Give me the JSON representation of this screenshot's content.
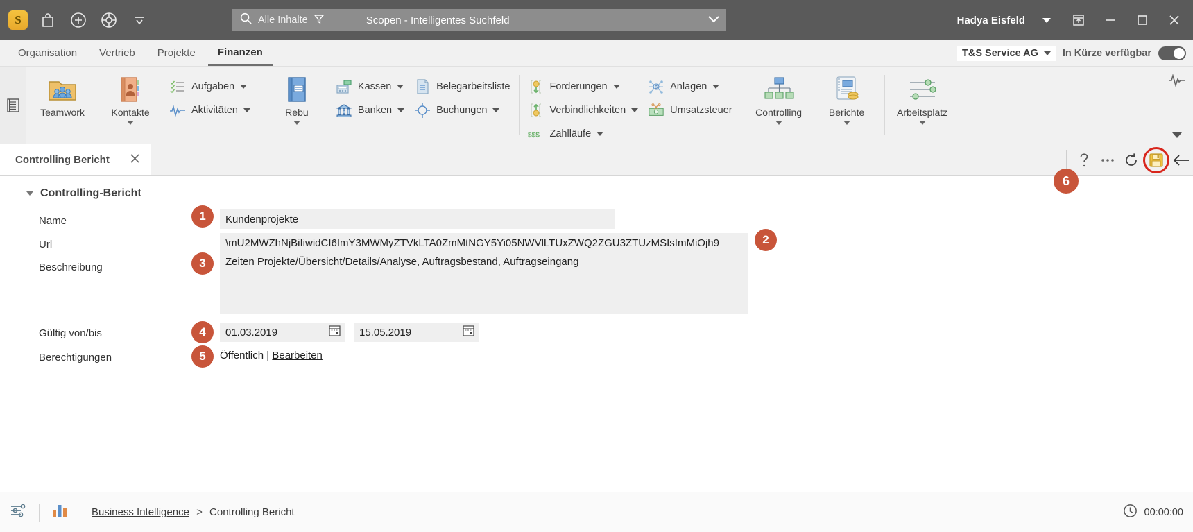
{
  "titlebar": {
    "logo_text": "S",
    "icons": [
      "bag-icon",
      "plus-circle-icon",
      "compass-icon",
      "chevron-down-icon"
    ],
    "search": {
      "scope_label": "Alle Inhalte",
      "filter_icon": "funnel-icon",
      "search_icon": "search-icon",
      "title": "Scopen - Intelligentes Suchfeld",
      "caret_icon": "chevron-down-icon"
    },
    "user": "Hadya Eisfeld",
    "user_caret_icon": "chevron-down-icon",
    "window_icons": [
      "restore-panel-icon",
      "minimize-icon",
      "maximize-icon",
      "close-icon"
    ]
  },
  "menubar": {
    "items": [
      {
        "label": "Organisation",
        "active": false
      },
      {
        "label": "Vertrieb",
        "active": false
      },
      {
        "label": "Projekte",
        "active": false
      },
      {
        "label": "Finanzen",
        "active": true
      }
    ],
    "company": "T&S Service AG",
    "availability_label": "In Kürze verfügbar",
    "toggle_on": true
  },
  "ribbon": {
    "rail_icon": "panel-list-icon",
    "groups": [
      {
        "big": [
          {
            "label": "Teamwork",
            "icon": "team-folder-icon",
            "caret": false
          },
          {
            "label": "Kontakte",
            "icon": "address-book-icon",
            "caret": true
          }
        ],
        "small": [
          {
            "label": "Aufgaben",
            "icon": "tasks-icon",
            "caret": true
          },
          {
            "label": "Aktivitäten",
            "icon": "activity-pulse-icon",
            "caret": true
          }
        ]
      },
      {
        "big": [
          {
            "label": "Rebu",
            "icon": "blue-book-icon",
            "caret": true
          }
        ],
        "small": [
          {
            "label": "Kassen",
            "icon": "cash-register-icon",
            "caret": true
          },
          {
            "label": "Banken",
            "icon": "bank-icon",
            "caret": true
          }
        ]
      },
      {
        "big": [],
        "small": [
          {
            "label": "Belegarbeitsliste",
            "icon": "document-list-icon",
            "caret": false
          },
          {
            "label": "Buchungen",
            "icon": "target-icon",
            "caret": true
          }
        ]
      },
      {
        "big": [],
        "small": [
          {
            "label": "Forderungen",
            "icon": "coin-in-icon",
            "caret": true
          },
          {
            "label": "Verbindlichkeiten",
            "icon": "coin-out-icon",
            "caret": true
          },
          {
            "label": "Zahlläufe",
            "icon": "money-flow-icon",
            "caret": true
          }
        ]
      },
      {
        "big": [],
        "small": [
          {
            "label": "Anlagen",
            "icon": "assets-network-icon",
            "caret": true
          },
          {
            "label": "Umsatzsteuer",
            "icon": "banknote-scissors-icon",
            "caret": false
          }
        ]
      },
      {
        "big": [
          {
            "label": "Controlling",
            "icon": "org-chart-icon",
            "caret": true
          },
          {
            "label": "Berichte",
            "icon": "report-coins-icon",
            "caret": true
          }
        ],
        "small": []
      },
      {
        "big": [
          {
            "label": "Arbeitsplatz",
            "icon": "sliders-icon",
            "caret": true
          }
        ],
        "small": []
      }
    ],
    "right_icons": [
      "pulse-icon",
      "chevron-down-icon"
    ]
  },
  "doctab": {
    "label": "Controlling Bericht",
    "close_icon": "close-icon",
    "tools": [
      {
        "name": "help-icon",
        "glyph": "?"
      },
      {
        "name": "more-options-icon",
        "glyph": "⋯"
      },
      {
        "name": "refresh-icon",
        "glyph": "↻"
      },
      {
        "name": "save-icon",
        "glyph": "floppy"
      },
      {
        "name": "back-arrow-icon",
        "glyph": "←"
      }
    ]
  },
  "form": {
    "group_title": "Controlling-Bericht",
    "fields": {
      "name": {
        "label": "Name",
        "value": "Kundenprojekte"
      },
      "url": {
        "label": "Url",
        "value": "\\mU2MWZhNjBiIiwidCI6ImY3MWMyZTVkLTA0ZmMtNGY5Yi05NWVlLTUxZWQ2ZGU3ZTUzMSIsImMiOjh9"
      },
      "description": {
        "label": "Beschreibung",
        "value": "Zeiten Projekte/Übersicht/Details/Analyse, Auftragsbestand, Auftragseingang"
      },
      "validity": {
        "label": "Gültig von/bis",
        "from": "01.03.2019",
        "to": "15.05.2019",
        "calendar_icon": "calendar-icon"
      },
      "permissions": {
        "label": "Berechtigungen",
        "value": "Öffentlich",
        "separator": "|",
        "link": "Bearbeiten"
      }
    },
    "badges": [
      "1",
      "2",
      "3",
      "4",
      "5",
      "6"
    ],
    "badge_color": "#c8553a"
  },
  "statusbar": {
    "left_icons": [
      "filter-list-icon",
      "bar-chart-icon"
    ],
    "breadcrumb_link": "Business Intelligence",
    "breadcrumb_separator": ">",
    "breadcrumb_current": "Controlling Bericht",
    "timer_icon": "clock-icon",
    "timer_value": "00:00:00"
  },
  "colors": {
    "titlebar_bg": "#5a5a5a",
    "accent_badge": "#c8553a",
    "save_ring": "#d8261c",
    "field_bg": "#efefef"
  }
}
